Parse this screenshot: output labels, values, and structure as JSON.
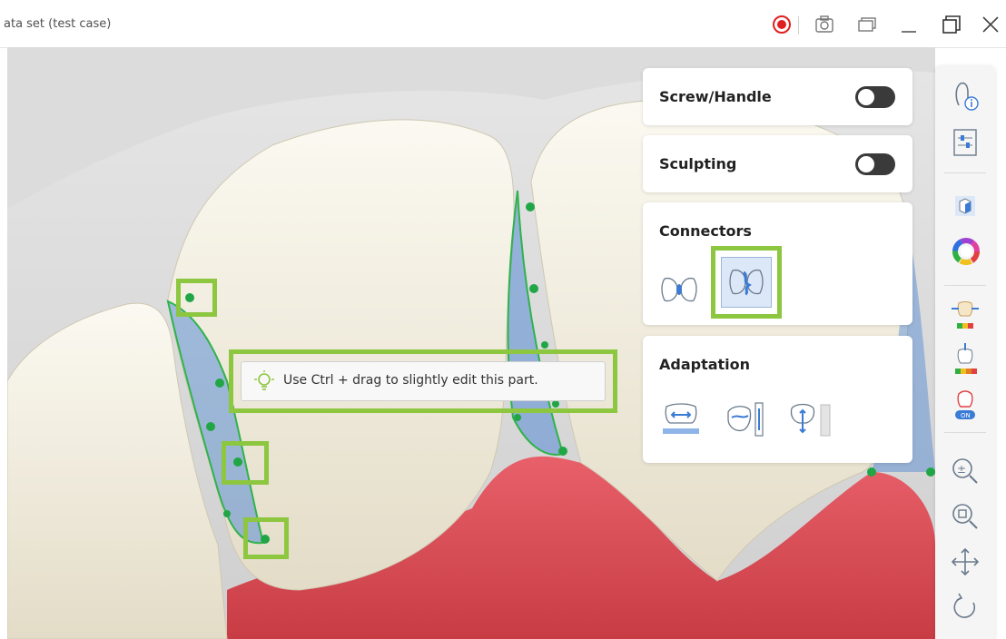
{
  "window": {
    "title": "ata set (test case)",
    "record_color": "#e02020",
    "icons": [
      "record-icon",
      "camera-icon",
      "screenshots-icon",
      "minimize-icon",
      "maximize-icon",
      "close-icon"
    ]
  },
  "panels": {
    "screw_handle": {
      "label": "Screw/Handle",
      "toggle_on": false
    },
    "sculpting": {
      "label": "Sculpting",
      "toggle_on": false
    },
    "connectors": {
      "label": "Connectors",
      "tools": [
        "connector-single-icon",
        "connector-double-icon"
      ],
      "selected": "connector-double-icon"
    },
    "adaptation": {
      "label": "Adaptation",
      "tools": [
        "fit-width-icon",
        "adjust-height-icon",
        "adjust-gap-icon"
      ]
    }
  },
  "hint": {
    "text": "Use Ctrl + drag to slightly edit this part.",
    "icon": "lightbulb-icon"
  },
  "sidebar": {
    "icons": [
      "tooth-info-icon",
      "settings-sliders-icon",
      "cube-view-icon",
      "color-wheel-icon",
      "tooth-gap-colormap-icon",
      "tooth-depth-colormap-icon",
      "margin-on-icon",
      "zoom-fit-icon",
      "zoom-reset-icon",
      "pan-icon",
      "rotate-icon"
    ],
    "margin_badge": "ON"
  },
  "colors": {
    "accent_highlight": "#8dc63f",
    "connector_blue": "#3a7bd5",
    "point_green": "#21a645",
    "gum": "#d84b4f",
    "tooth": "#f1ede0"
  }
}
